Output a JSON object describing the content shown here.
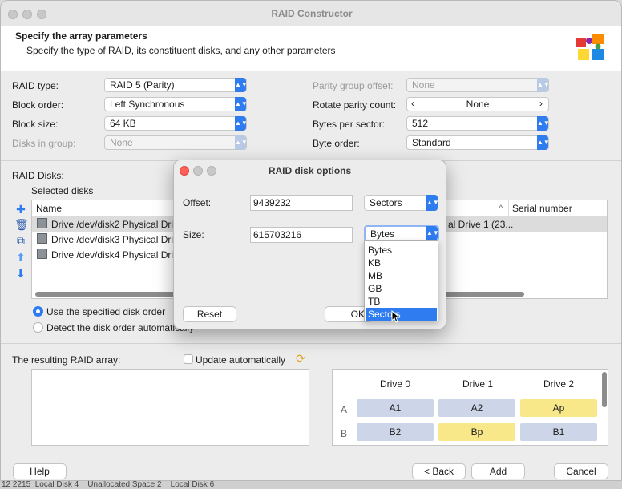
{
  "window": {
    "title": "RAID Constructor"
  },
  "header": {
    "title": "Specify the array parameters",
    "subtitle": "Specify the type of RAID, its constituent disks, and any other parameters"
  },
  "params_left": [
    {
      "label": "RAID type:",
      "value": "RAID 5 (Parity)",
      "enabled": true
    },
    {
      "label": "Block order:",
      "value": "Left Synchronous",
      "enabled": true
    },
    {
      "label": "Block size:",
      "value": "64 KB",
      "enabled": true
    },
    {
      "label": "Disks in group:",
      "value": "None",
      "enabled": false
    }
  ],
  "params_right": [
    {
      "label": "Parity group offset:",
      "value": "None",
      "enabled": false
    },
    {
      "label": "Rotate parity count:",
      "value": "None",
      "enabled": true
    },
    {
      "label": "Bytes per sector:",
      "value": "512",
      "enabled": true
    },
    {
      "label": "Byte order:",
      "value": "Standard",
      "enabled": true
    }
  ],
  "disks": {
    "section_label": "RAID Disks:",
    "selected_label": "Selected disks",
    "columns": {
      "name": "Name",
      "serial": "Serial number"
    },
    "rows": [
      "Drive /dev/disk2 Physical Drive",
      "Drive /dev/disk3 Physical Drive",
      "Drive /dev/disk4 Physical Drive"
    ],
    "right_partial": "al Drive 1 (23..."
  },
  "order": {
    "option1": "Use the specified disk order",
    "option2": "Detect the disk order automatically"
  },
  "result": {
    "label": "The resulting RAID array:",
    "update_label": "Update automatically"
  },
  "grid": {
    "drives": [
      "Drive 0",
      "Drive 1",
      "Drive 2"
    ],
    "rows": [
      {
        "label": "A",
        "cells": [
          "A1",
          "A2",
          "Ap"
        ],
        "parity_index": 2
      },
      {
        "label": "B",
        "cells": [
          "B2",
          "Bp",
          "B1"
        ],
        "parity_index": 1
      }
    ],
    "colors": {
      "data": "#cdd5e8",
      "parity": "#f9e88a"
    }
  },
  "buttons": {
    "help": "Help",
    "back": "< Back",
    "add": "Add",
    "cancel": "Cancel"
  },
  "dialog": {
    "title": "RAID disk options",
    "offset_label": "Offset:",
    "offset_value": "9439232",
    "offset_unit": "Sectors",
    "size_label": "Size:",
    "size_value": "615703216",
    "size_unit": "Bytes",
    "reset": "Reset",
    "ok": "OK"
  },
  "dropdown": {
    "options": [
      "Bytes",
      "KB",
      "MB",
      "GB",
      "TB",
      "Sectors"
    ],
    "highlighted": "Sectors"
  },
  "background_text": {
    "partial_bottom": "12 2215  Local Disk 4    Unallocated Space 2    Local Disk 6"
  },
  "accent_color": "#2f7bf0"
}
